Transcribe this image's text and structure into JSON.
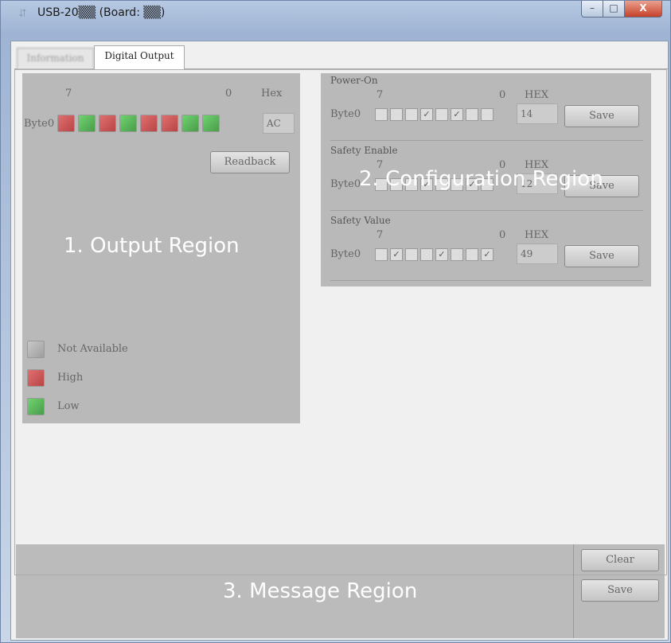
{
  "window": {
    "title": "USB-20▒▒ (Board: ▒▒)",
    "caption": {
      "minimize": "–",
      "maximize": "□",
      "close": "X"
    }
  },
  "tabs": [
    {
      "label": "Information"
    },
    {
      "label": "Digital Output"
    }
  ],
  "output": {
    "bit_high_label": "7",
    "bit_low_label": "0",
    "hex_header": "Hex",
    "byte_label": "Byte0",
    "bits": [
      "high",
      "low",
      "high",
      "low",
      "high",
      "high",
      "low",
      "low"
    ],
    "hex_value": "AC",
    "readback_label": "Readback",
    "legend": [
      {
        "state": "na",
        "label": "Not Available"
      },
      {
        "state": "high",
        "label": "High"
      },
      {
        "state": "low",
        "label": "Low"
      }
    ],
    "overlay_label": "1. Output Region"
  },
  "config": {
    "overlay_label": "2. Configuration Region",
    "groups": [
      {
        "title": "Power-On",
        "bit_high": "7",
        "bit_low": "0",
        "hex_header": "HEX",
        "byte_label": "Byte0",
        "checks": [
          false,
          false,
          false,
          true,
          false,
          true,
          false,
          false
        ],
        "hex_value": "14",
        "save_label": "Save"
      },
      {
        "title": "Safety Enable",
        "bit_high": "7",
        "bit_low": "0",
        "hex_header": "HEX",
        "byte_label": "Byte0",
        "checks": [
          false,
          false,
          false,
          true,
          false,
          false,
          true,
          false
        ],
        "hex_value": "12",
        "save_label": "Save"
      },
      {
        "title": "Safety Value",
        "bit_high": "7",
        "bit_low": "0",
        "hex_header": "HEX",
        "byte_label": "Byte0",
        "checks": [
          false,
          true,
          false,
          false,
          true,
          false,
          false,
          true
        ],
        "hex_value": "49",
        "save_label": "Save"
      }
    ]
  },
  "message": {
    "overlay_label": "3. Message Region",
    "clear_label": "Clear",
    "save_label": "Save"
  }
}
